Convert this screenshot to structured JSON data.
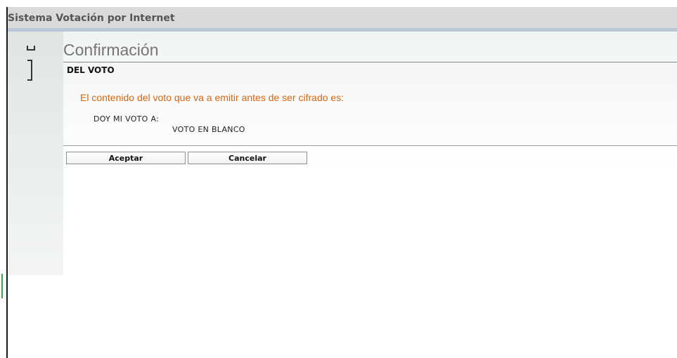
{
  "window": {
    "title": "Sistema Votación por Internet"
  },
  "page": {
    "heading": "Confirmación",
    "subheading": "DEL VOTO",
    "notice": "El contenido del voto que va a emitir antes de ser cifrado es:",
    "vote": {
      "line1": "DOY MI VOTO A:",
      "line2": "VOTO EN BLANCO"
    }
  },
  "buttons": {
    "accept": "Aceptar",
    "cancel": "Cancelar"
  },
  "sidebar": {
    "icons": [
      "minimize-icon",
      "window-bar-icon"
    ]
  },
  "colors": {
    "notice": "#d8650f",
    "title_bar": "#dadada",
    "accent_rule": "#b8c8d6"
  }
}
